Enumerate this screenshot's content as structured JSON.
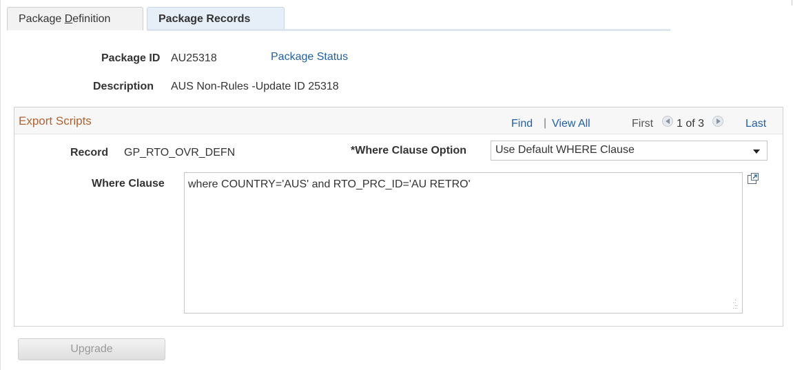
{
  "tabs": [
    {
      "label_pre": "Package ",
      "label_underlined": "D",
      "label_post": "efinition"
    },
    {
      "label": "Package Records"
    }
  ],
  "header": {
    "package_id_label": "Package ID",
    "package_id_value": "AU25318",
    "package_status_link": "Package Status",
    "description_label": "Description",
    "description_value": "AUS Non-Rules -Update ID 25318"
  },
  "export_scripts": {
    "title": "Export Scripts",
    "find": "Find",
    "separator": "|",
    "view_all": "View All",
    "first": "First",
    "pager": "1 of 3",
    "last": "Last",
    "record_label": "Record",
    "record_value": "GP_RTO_OVR_DEFN",
    "where_option_label": "*Where Clause Option",
    "where_option_value": "Use Default WHERE Clause",
    "where_clause_label": "Where Clause",
    "where_clause_value": "where  COUNTRY='AUS' and RTO_PRC_ID='AU RETRO'"
  },
  "actions": {
    "upgrade": "Upgrade"
  },
  "icons": {
    "prev": "previous-arrow-icon",
    "next": "next-arrow-icon",
    "expand": "expand-textarea-icon"
  },
  "colors": {
    "link": "#1f5fa8",
    "group_title": "#b4612e",
    "active_tab_bg": "#e6eef7"
  }
}
